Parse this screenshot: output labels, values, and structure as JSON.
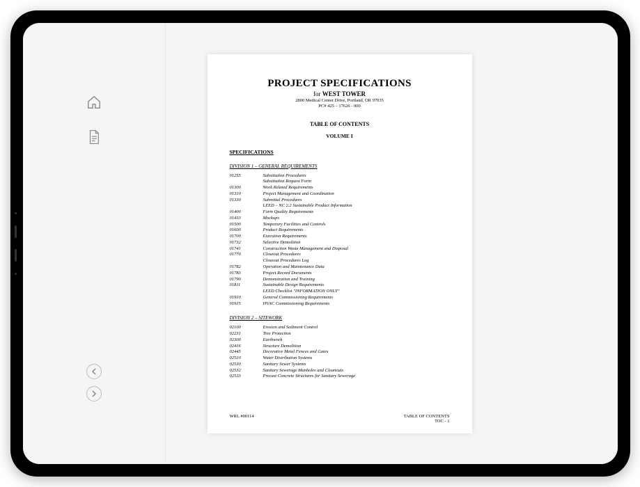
{
  "document": {
    "title_main": "PROJECT SPECIFICATIONS",
    "title_for": "for ",
    "title_project": "WEST TOWER",
    "address": "2800 Medical Center Drive, Portland, OR 97035",
    "pc": "PC#  425 – 17626 - 000",
    "toc_heading": "TABLE OF CONTENTS",
    "volume": "VOLUME  I",
    "spec_heading": "SPECIFICATIONS",
    "div1_heading": "DIVISION 1 – GENERAL REQUIREMENTS",
    "div1_items": [
      {
        "code": "01255",
        "title": "Substitution Procedures"
      },
      {
        "code": "",
        "title": "Substitution Request Form"
      },
      {
        "code": "01300",
        "title": "Work Related Requirements"
      },
      {
        "code": "01310",
        "title": "Project Management and Coordination"
      },
      {
        "code": "01330",
        "title": "Submittal Procedures"
      },
      {
        "code": "",
        "title": "LEED – NC 2.2 Sustainable Product Information"
      },
      {
        "code": "01400",
        "title": "Form Quality Requirements"
      },
      {
        "code": "01433",
        "title": "Mockups"
      },
      {
        "code": "01500",
        "title": "Temporary Facilities and Controls"
      },
      {
        "code": "01600",
        "title": "Product Requirements"
      },
      {
        "code": "01700",
        "title": "Execution Requirements"
      },
      {
        "code": "01732",
        "title": "Selective Demolition"
      },
      {
        "code": "01741",
        "title": "Construction Waste Management and Disposal"
      },
      {
        "code": "01770",
        "title": "Closeout Procedures"
      },
      {
        "code": "",
        "title": "Closeout Procedures Log"
      },
      {
        "code": "01782",
        "title": "Operation and Maintenance Data"
      },
      {
        "code": "01783",
        "title": "Project Record Documents"
      },
      {
        "code": "01790",
        "title": "Demonstration and Training"
      },
      {
        "code": "01811",
        "title": "Sustainable Design Requirements"
      },
      {
        "code": "",
        "title": "LEED Checklist \"INFORMATION ONLY\""
      },
      {
        "code": "01910",
        "title": "General Commissioning Requirements"
      },
      {
        "code": "01915",
        "title": "HVAC Commissioning Requirements"
      }
    ],
    "div2_heading": "DIVISION 2 – SITEWORK",
    "div2_items": [
      {
        "code": "02100",
        "title": "Erosion and Sediment Control"
      },
      {
        "code": "02231",
        "title": "Tree Protection"
      },
      {
        "code": "02300",
        "title": "Earthwork"
      },
      {
        "code": "02416",
        "title": "Structure Demolition"
      },
      {
        "code": "02445",
        "title": "Decorative Metal Fences and Gates"
      },
      {
        "code": "02510",
        "title": "Water Distribution Systems"
      },
      {
        "code": "02530",
        "title": "Sanitary Sewer Systems"
      },
      {
        "code": "02532",
        "title": "Sanitary Sewerage Manholes and Cleanouts"
      },
      {
        "code": "02533",
        "title": "Precast Concrete Structures for Sanitary Sewerage"
      }
    ],
    "footer_left": "WRL #00114",
    "footer_right1": "TABLE OF CONTENTS",
    "footer_right2": "TOC - 1"
  }
}
